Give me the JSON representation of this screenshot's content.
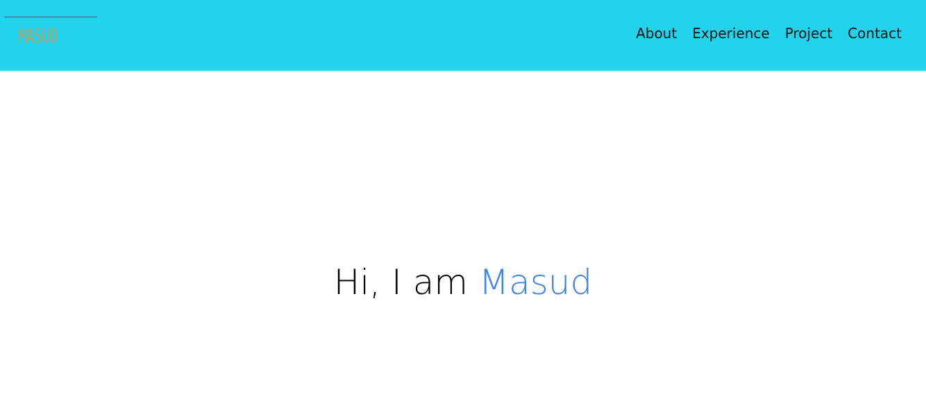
{
  "header": {
    "logo_text": "MASUD",
    "nav": [
      {
        "label": "About"
      },
      {
        "label": "Experience"
      },
      {
        "label": "Project"
      },
      {
        "label": "Contact"
      }
    ]
  },
  "hero": {
    "greeting": "Hi, I am ",
    "name": "Masud"
  },
  "colors": {
    "header_bg": "#22d3ee",
    "accent": "#3b82f6",
    "logo": "#c0a060"
  }
}
